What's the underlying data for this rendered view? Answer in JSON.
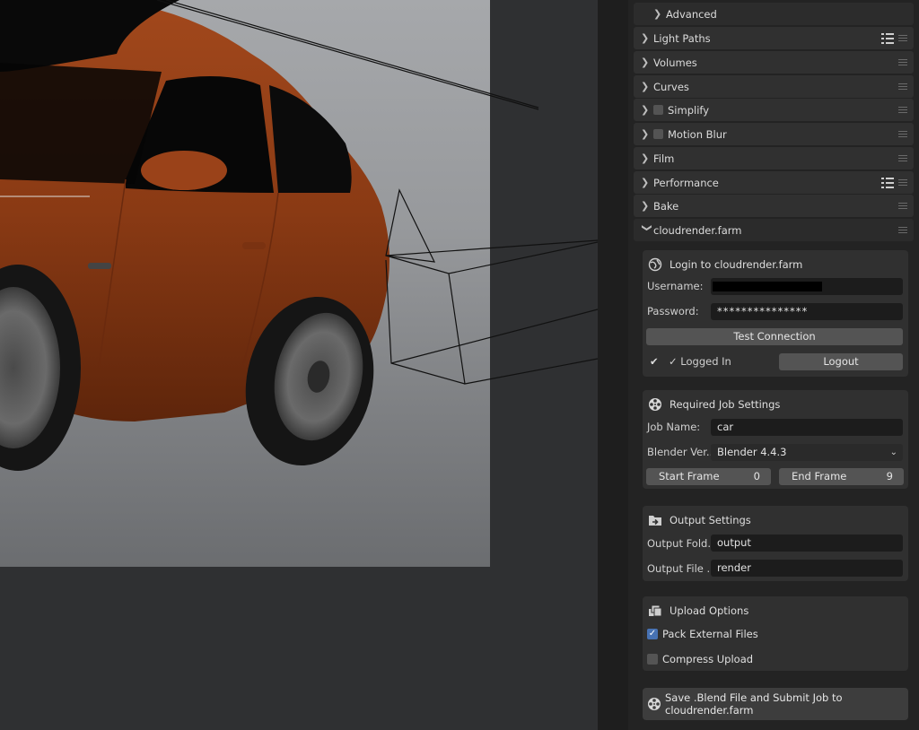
{
  "panel": {
    "advanced_label": "Advanced",
    "sections": [
      {
        "label": "Light Paths"
      },
      {
        "label": "Volumes"
      },
      {
        "label": "Curves"
      },
      {
        "label": "Simplify"
      },
      {
        "label": "Motion Blur"
      },
      {
        "label": "Film"
      },
      {
        "label": "Performance"
      },
      {
        "label": "Bake"
      },
      {
        "label": "cloudrender.farm"
      }
    ]
  },
  "login": {
    "title": "Login to cloudrender.farm",
    "username_label": "Username:",
    "password_label": "Password:",
    "password_value": "***************",
    "test_button": "Test Connection",
    "status": "✓ Logged In",
    "logout_button": "Logout"
  },
  "job": {
    "title": "Required Job Settings",
    "name_label": "Job Name:",
    "name_value": "car",
    "version_label": "Blender Ver...",
    "version_value": "Blender 4.4.3",
    "start_label": "Start Frame",
    "start_value": "0",
    "end_label": "End Frame",
    "end_value": "9"
  },
  "output": {
    "title": "Output Settings",
    "folder_label": "Output Fold...",
    "folder_value": "output",
    "file_label": "Output File ...",
    "file_value": "render"
  },
  "upload": {
    "title": "Upload Options",
    "pack_label": "Pack External Files",
    "compress_label": "Compress Upload"
  },
  "submit_label": "Save .Blend File and Submit Job to cloudrender.farm",
  "colors": {
    "car_paint": "#8a3a14",
    "accent_checkbox": "#4772b3",
    "panel_bg": "#303030"
  }
}
